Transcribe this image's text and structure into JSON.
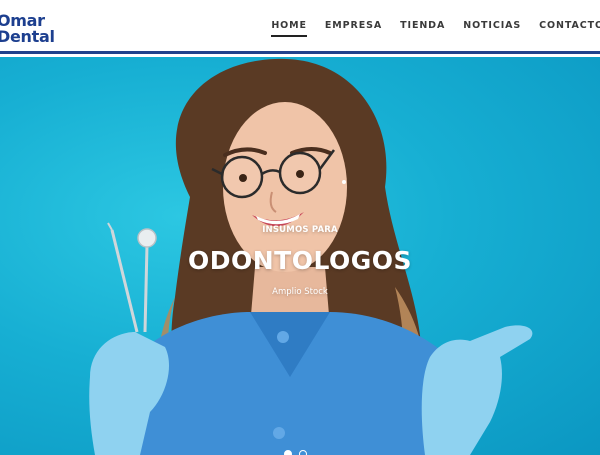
{
  "brand": {
    "line1": "Omar",
    "line2": "Dental",
    "color": "#1d3f8f"
  },
  "nav": {
    "items": [
      "HOME",
      "EMPRESA",
      "TIENDA",
      "NOTICIAS",
      "CONTACTO"
    ],
    "active": "HOME"
  },
  "hero": {
    "kicker": "INSUMOS PARA",
    "title": "ODONTOLOGOS",
    "subtitle": "Amplio Stock",
    "background_color": "#17afd3",
    "slides_total": 2,
    "active_slide": 1
  },
  "colors": {
    "header_rule": "#22428c",
    "hero_text": "#ffffff",
    "scrubs": "#3f8fd6",
    "gloves": "#8fd2f0"
  },
  "icons": [
    "dental-mirror-icon",
    "dental-probe-icon"
  ]
}
